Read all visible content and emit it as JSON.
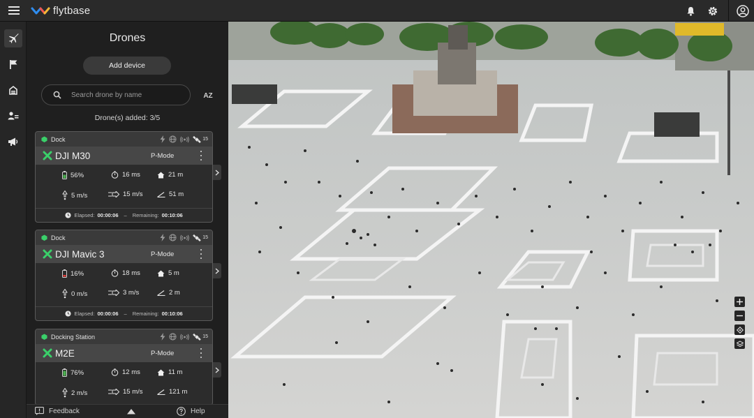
{
  "app": {
    "brand": "flytbase"
  },
  "topbar": {
    "icons": [
      "menu-icon",
      "bell-icon",
      "gear-icon",
      "account-icon"
    ]
  },
  "rail": {
    "items": [
      "plane-icon",
      "flag-icon",
      "dock-icon",
      "users-icon",
      "megaphone-icon"
    ],
    "active": "plane-icon"
  },
  "panel": {
    "title": "Drones",
    "add_label": "Add device",
    "search_placeholder": "Search drone by name",
    "sort_label": "AZ",
    "count_text": "Drone(s) added: 3/5"
  },
  "drones": [
    {
      "dock": "Dock",
      "signal": "15",
      "name": "DJI M30",
      "mode": "P-Mode",
      "battery": "56%",
      "latency": "16 ms",
      "altitude": "21 m",
      "vspeed": "5 m/s",
      "hspeed": "15 m/s",
      "distance": "51 m",
      "elapsed_label": "Elapsed:",
      "elapsed": "00:00:06",
      "dash": "–",
      "remaining_label": "Remaining:",
      "remaining": "00:10:06",
      "battery_color": "#4caf50"
    },
    {
      "dock": "Dock",
      "signal": "15",
      "name": "DJI Mavic 3",
      "mode": "P-Mode",
      "battery": "16%",
      "latency": "18 ms",
      "altitude": "5 m",
      "vspeed": "0 m/s",
      "hspeed": "3 m/s",
      "distance": "2 m",
      "elapsed_label": "Elapsed:",
      "elapsed": "00:00:06",
      "dash": "–",
      "remaining_label": "Remaining:",
      "remaining": "00:10:06",
      "battery_color": "#e53935"
    },
    {
      "dock": "Docking Station",
      "signal": "15",
      "name": "M2E",
      "mode": "P-Mode",
      "battery": "76%",
      "latency": "12 ms",
      "altitude": "11 m",
      "vspeed": "2 m/s",
      "hspeed": "15 m/s",
      "distance": "121 m",
      "battery_color": "#4caf50"
    }
  ],
  "footer": {
    "feedback": "Feedback",
    "help": "Help"
  },
  "colors": {
    "accent_green": "#3ad06a",
    "panel_bg": "#1f1f1f",
    "topbar_bg": "#2a2a2a"
  }
}
